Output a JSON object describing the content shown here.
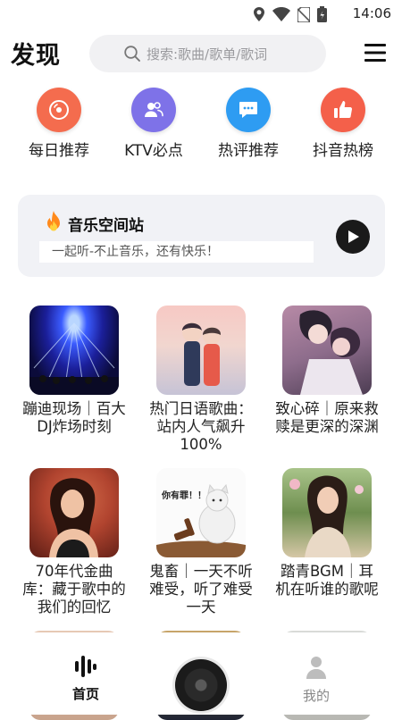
{
  "status_bar": {
    "time": "14:06",
    "icons": [
      "location-icon",
      "wifi-icon",
      "no-sim-icon",
      "battery-icon"
    ]
  },
  "header": {
    "title": "发现",
    "search_placeholder": "搜索:歌曲/歌单/歌词",
    "menu_icon": "hamburger-menu-icon"
  },
  "categories": [
    {
      "label": "每日推荐",
      "icon": "record-disc-icon",
      "color": "#f46c4e"
    },
    {
      "label": "KTV必点",
      "icon": "users-icon",
      "color": "#7e72e8"
    },
    {
      "label": "热评推荐",
      "icon": "chat-bubble-icon",
      "color": "#2e9cf2"
    },
    {
      "label": "抖音热榜",
      "icon": "thumbs-up-icon",
      "color": "#f4604a"
    }
  ],
  "banner": {
    "title": "音乐空间站",
    "subtitle": "一起听-不止音乐，还有快乐！",
    "icon": "fire-icon",
    "action_icon": "play-icon"
  },
  "playlists": [
    {
      "title": "蹦迪现场｜百大DJ炸场时刻",
      "cover": "concert-lights"
    },
    {
      "title": "热门日语歌曲：站内人气飙升100%",
      "cover": "anime-couple"
    },
    {
      "title": "致心碎｜原来救赎是更深的深渊",
      "cover": "anime-embrace"
    },
    {
      "title": "70年代金曲库：藏于歌中的我们的回忆",
      "cover": "retro-portrait"
    },
    {
      "title": "鬼畜｜一天不听难受，听了难受一天",
      "cover": "cat-meme",
      "cover_caption": "你有罪！！"
    },
    {
      "title": "踏青BGM｜耳机在听谁的歌呢",
      "cover": "spring-portrait"
    }
  ],
  "bottom_nav": {
    "home_label": "首页",
    "mine_label": "我的"
  },
  "colors": {
    "accent_text": "#111111",
    "banner_bg": "#f1f2f6",
    "search_bg": "#f1f1f3"
  }
}
